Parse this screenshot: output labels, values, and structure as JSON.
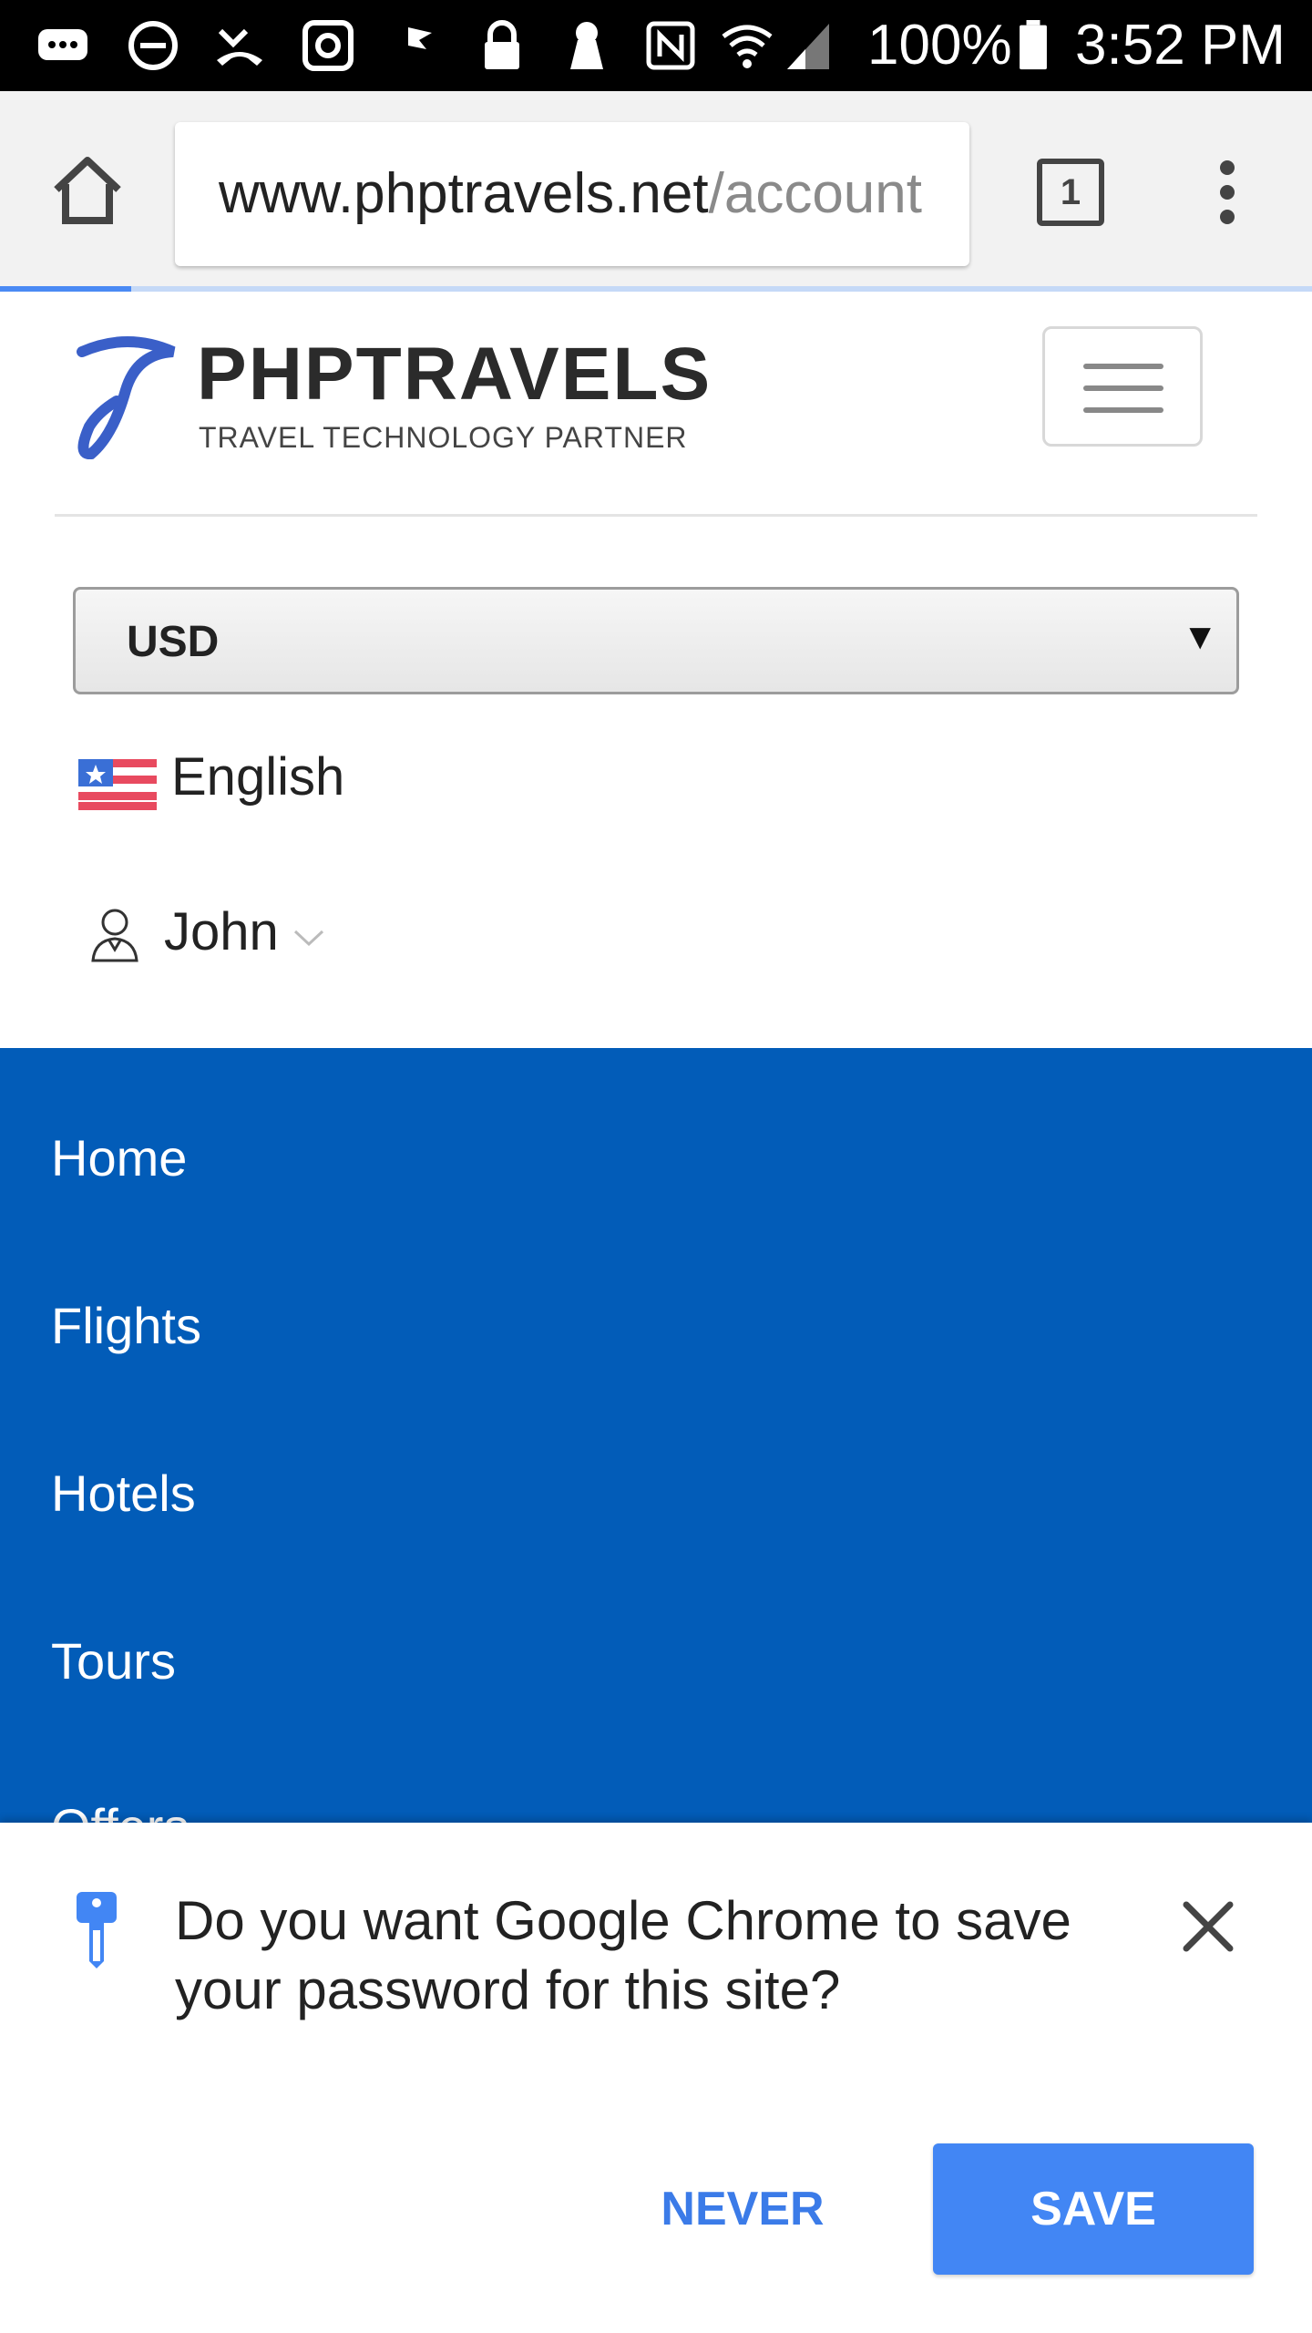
{
  "status_bar": {
    "battery_text": "100%",
    "time": "3:52 PM",
    "icons": [
      "messages-icon",
      "do-not-disturb-icon",
      "missed-call-icon",
      "instagram-icon",
      "flag-icon",
      "lock-icon",
      "keyhole-icon",
      "nfc-icon",
      "wifi-icon",
      "signal-icon",
      "battery-icon"
    ]
  },
  "browser": {
    "url_host": "www.phptravels.net",
    "url_path": "/account",
    "tab_count": "1",
    "page_load_progress": 0.1
  },
  "site": {
    "logo_text": "PHPTRAVELS",
    "logo_tagline": "TRAVEL TECHNOLOGY PARTNER",
    "brand_color": "#3a5fc8",
    "currency": {
      "selected": "USD"
    },
    "language": {
      "label": "English"
    },
    "user": {
      "name": "John"
    }
  },
  "nav": {
    "background": "#025cb8",
    "items": [
      {
        "label": "Home"
      },
      {
        "label": "Flights"
      },
      {
        "label": "Hotels"
      },
      {
        "label": "Tours"
      },
      {
        "label": "Offers"
      }
    ]
  },
  "password_prompt": {
    "message": "Do you want Google Chrome to save your password for this site?",
    "never_label": "NEVER",
    "save_label": "SAVE",
    "accent": "#4286f4"
  }
}
